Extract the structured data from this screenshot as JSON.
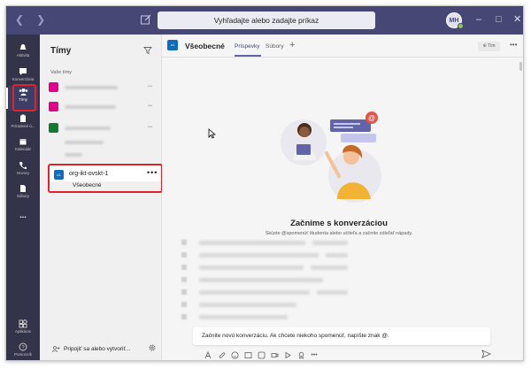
{
  "titlebar": {
    "search_placeholder": "Vyhľadajte alebo zadajte príkaz",
    "avatar_initials": "MH",
    "presence_color": "#92c353",
    "minimize": "–",
    "maximize": "□",
    "close": "✕"
  },
  "rail": {
    "items": [
      {
        "label": "Aktivita",
        "icon": "bell-icon"
      },
      {
        "label": "Konverzácia",
        "icon": "chat-icon"
      },
      {
        "label": "Tímy",
        "icon": "teams-icon",
        "active": true
      },
      {
        "label": "Priradené ú...",
        "icon": "assignments-icon"
      },
      {
        "label": "Kalendár",
        "icon": "calendar-icon"
      },
      {
        "label": "Hovory",
        "icon": "phone-icon"
      },
      {
        "label": "Súbory",
        "icon": "files-icon"
      },
      {
        "label": "...",
        "icon": "more-icon"
      }
    ],
    "apps_label": "Aplikácie",
    "help_label": "Pomocník"
  },
  "teams_panel": {
    "title": "Tímy",
    "section_label": "Vaše tímy",
    "blurred_teams_colors": [
      "#e3008c",
      "#e3008c",
      "#0f7b2c"
    ],
    "selected_team": {
      "tile_text": "o1",
      "name": "org-ikt-ovskt-1",
      "more": "•••",
      "channel": "Všeobecné"
    },
    "join_label": "Pripojiť sa alebo vytvoriť..."
  },
  "channel_header": {
    "tile_text": "o1",
    "title": "Všeobecné",
    "tabs": [
      "Príspevky",
      "Súbory"
    ],
    "add_tab": "+",
    "team_button": "⊕ Tím",
    "more": "•••"
  },
  "conversation": {
    "welcome_title": "Začnime s konverzáciou",
    "welcome_subtitle": "Skúste @spomenúť študenta alebo učiteľa a začnite zdieľať nápady.",
    "compose_placeholder": "Začnite novú konverzáciu. Ak chcete niekoho spomenúť, napíšte znak @."
  },
  "colors": {
    "titlebar": "#464775",
    "rail": "#33344a",
    "accent": "#6264a7",
    "highlight": "#e0232b"
  }
}
